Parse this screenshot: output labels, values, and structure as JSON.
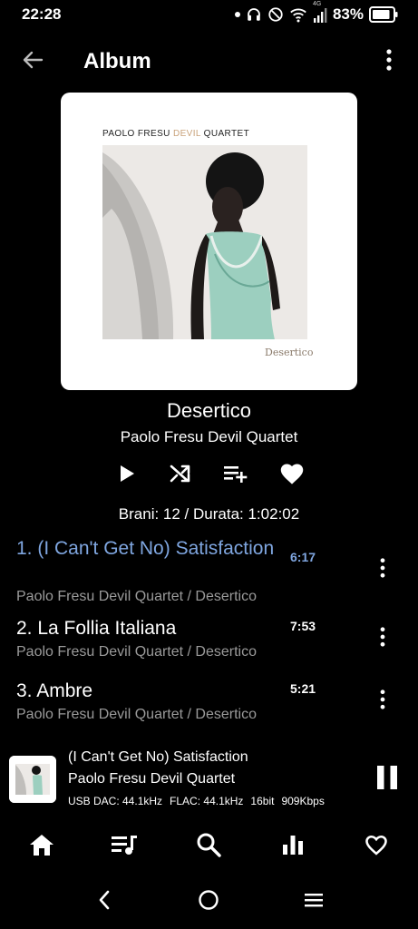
{
  "status": {
    "time": "22:28",
    "battery_percent": "83%",
    "network": "4G",
    "icons": [
      "dot-icon",
      "headphones-icon",
      "do-not-disturb-icon",
      "wifi-icon",
      "signal-icon",
      "battery-icon"
    ]
  },
  "app_bar": {
    "title": "Album",
    "back_icon": "arrow-left-icon",
    "overflow_icon": "more-vertical-icon"
  },
  "cover": {
    "band_prefix": "PAOLO FRESU ",
    "band_devil": "DEVIL",
    "band_suffix": " QUARTET",
    "art_title": "Desertico"
  },
  "album": {
    "name": "Desertico",
    "artist": "Paolo Fresu Devil Quartet",
    "summary": "Brani: 12 / Durata: 1:02:02"
  },
  "actions": [
    {
      "name": "play",
      "icon": "play-icon"
    },
    {
      "name": "shuffle",
      "icon": "shuffle-icon"
    },
    {
      "name": "add-to-queue",
      "icon": "playlist-add-icon"
    },
    {
      "name": "favorite",
      "icon": "heart-icon"
    }
  ],
  "tracks": [
    {
      "number_title": "1. (I Can't Get No) Satisfaction",
      "subtitle": "Paolo Fresu Devil Quartet / Desertico",
      "duration": "6:17",
      "active": true
    },
    {
      "number_title": "2. La Follia Italiana",
      "subtitle": "Paolo Fresu Devil Quartet / Desertico",
      "duration": "7:53",
      "active": false
    },
    {
      "number_title": "3. Ambre",
      "subtitle": "Paolo Fresu Devil Quartet / Desertico",
      "duration": "5:21",
      "active": false
    }
  ],
  "now_playing": {
    "title": "(I Can't Get No) Satisfaction",
    "artist": "Paolo Fresu Devil Quartet",
    "output": "USB DAC: 44.1kHz",
    "format": "FLAC: 44.1kHz",
    "bit_depth": "16bit",
    "bitrate": "909Kbps",
    "pause_icon": "pause-icon"
  },
  "bottom_nav": [
    {
      "name": "home",
      "icon": "home-icon"
    },
    {
      "name": "queue",
      "icon": "queue-music-icon"
    },
    {
      "name": "search",
      "icon": "search-icon"
    },
    {
      "name": "equalizer",
      "icon": "equalizer-icon"
    },
    {
      "name": "favorites",
      "icon": "heart-outline-icon"
    }
  ],
  "colors": {
    "background": "#000000",
    "accent": "#7fa6e0",
    "secondary_text": "#9a9a9a"
  }
}
